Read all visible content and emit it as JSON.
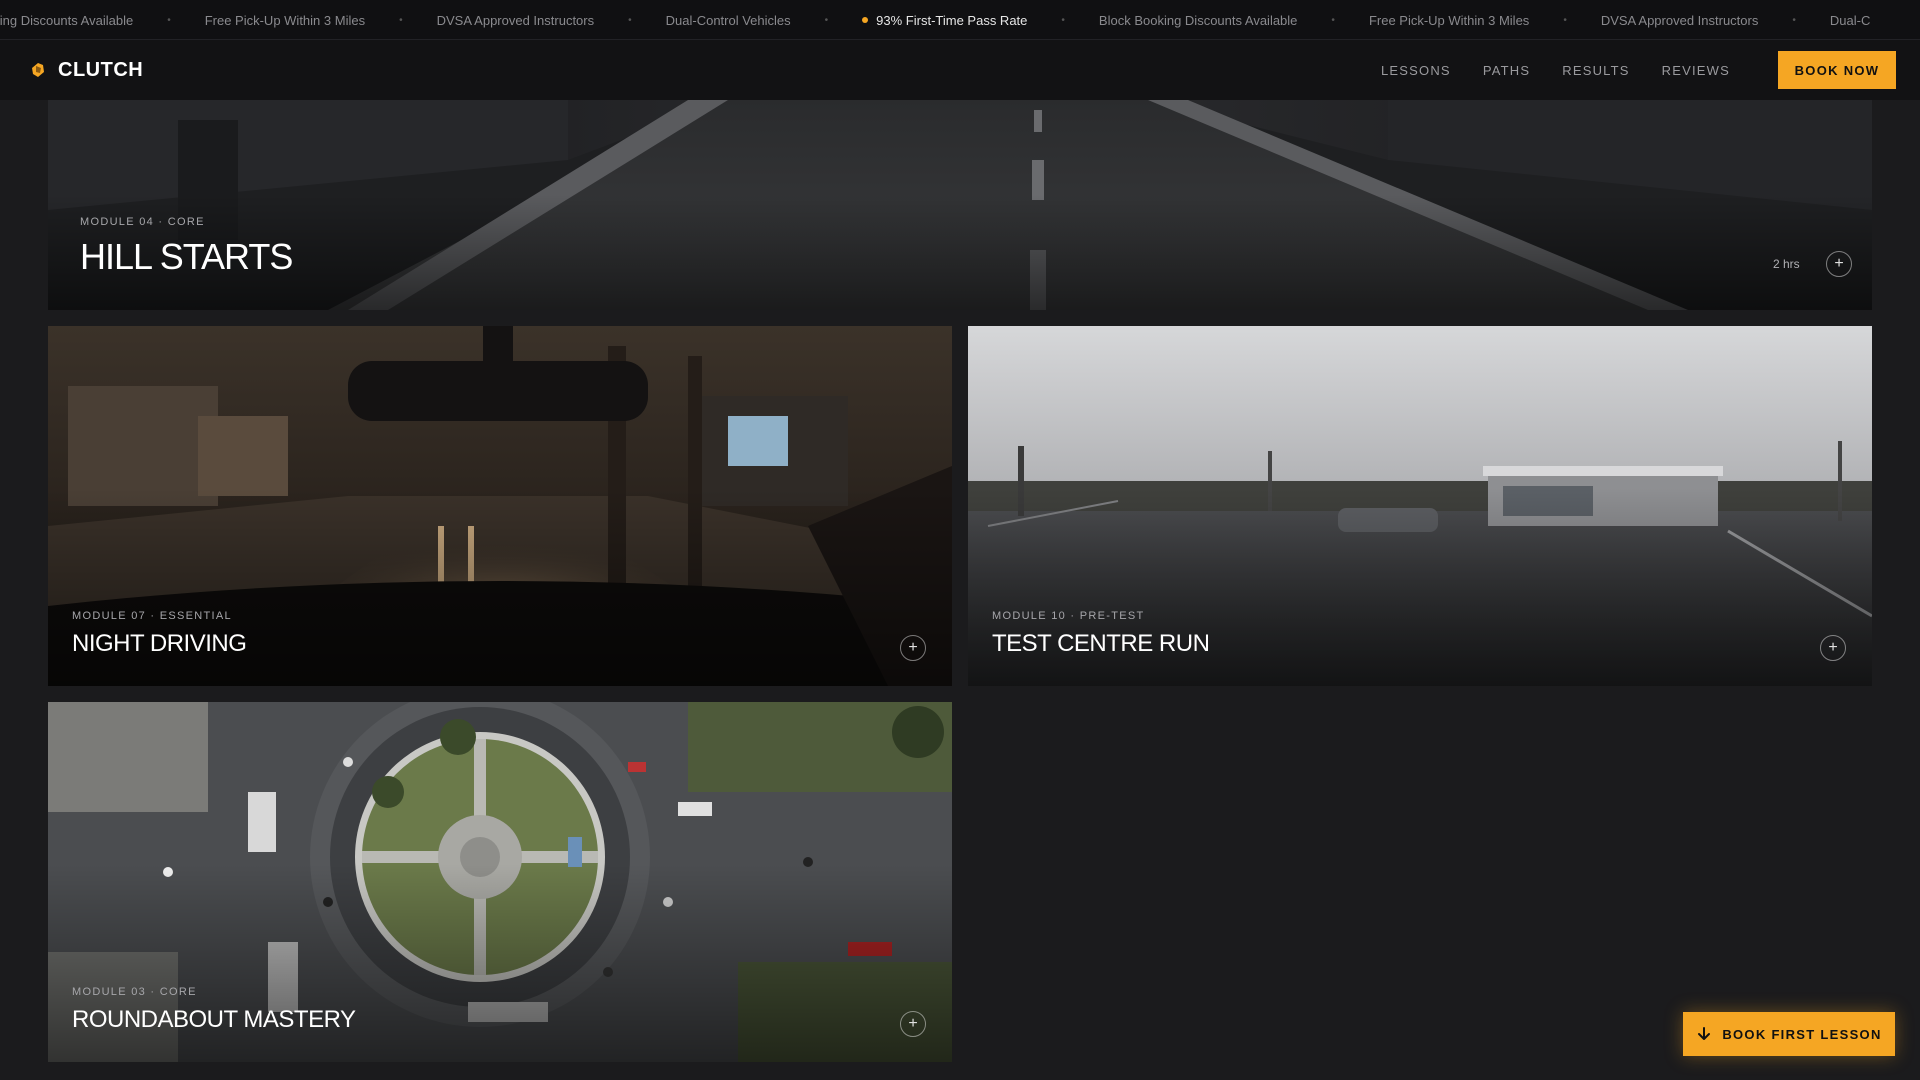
{
  "ticker": {
    "items": [
      {
        "text": "oking Discounts Available",
        "highlight": false
      },
      {
        "text": "Free Pick-Up Within 3 Miles",
        "highlight": false
      },
      {
        "text": "DVSA Approved Instructors",
        "highlight": false
      },
      {
        "text": "Dual-Control Vehicles",
        "highlight": false
      },
      {
        "text": "93% First-Time Pass Rate",
        "highlight": true
      },
      {
        "text": "Block Booking Discounts Available",
        "highlight": false
      },
      {
        "text": "Free Pick-Up Within 3 Miles",
        "highlight": false
      },
      {
        "text": "DVSA Approved Instructors",
        "highlight": false
      },
      {
        "text": "Dual-C",
        "highlight": false
      }
    ],
    "separator": "•"
  },
  "header": {
    "brand": "CLUTCH",
    "nav": [
      "LESSONS",
      "PATHS",
      "RESULTS",
      "REVIEWS"
    ],
    "cta": "BOOK NOW"
  },
  "modules": [
    {
      "meta": "MODULE 04 · CORE",
      "title": "HILL STARTS",
      "duration": "2 hrs",
      "plus": "+"
    },
    {
      "meta": "MODULE 07 · ESSENTIAL",
      "title": "NIGHT DRIVING",
      "plus": "+"
    },
    {
      "meta": "MODULE 10 · PRE-TEST",
      "title": "TEST CENTRE RUN",
      "plus": "+"
    },
    {
      "meta": "MODULE 03 · CORE",
      "title": "ROUNDABOUT MASTERY",
      "plus": "+"
    }
  ],
  "floating_cta": {
    "label": "BOOK FIRST LESSON",
    "icon": "arrow-down-icon"
  },
  "colors": {
    "accent": "#f5a623",
    "background": "#1b1b1d",
    "header": "#121214"
  }
}
